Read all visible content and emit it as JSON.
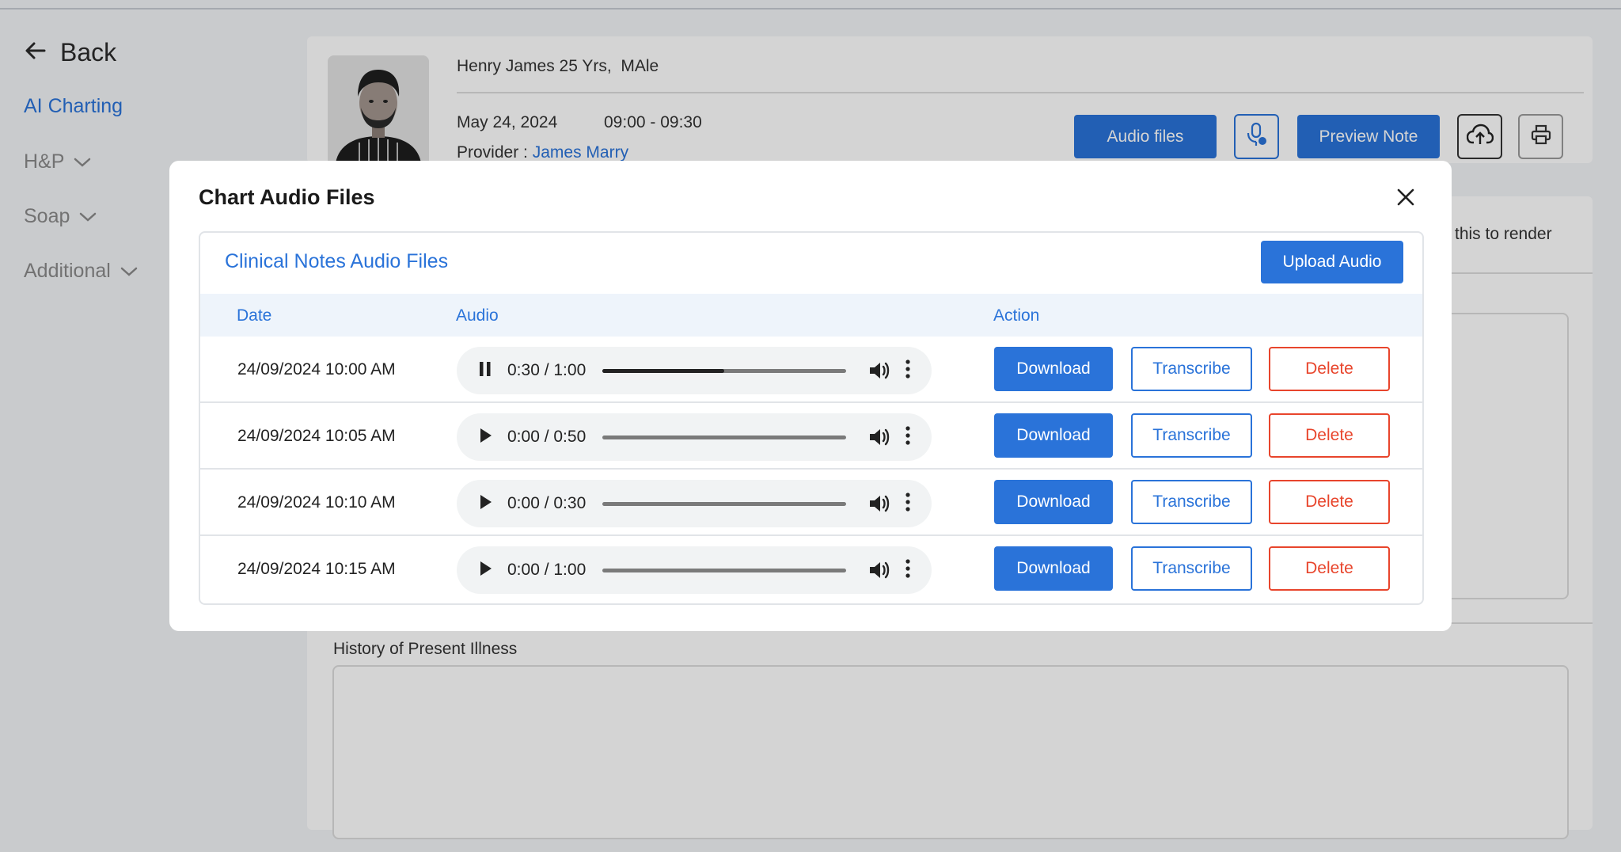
{
  "sidebar": {
    "back_label": "Back",
    "items": [
      {
        "label": "AI Charting"
      },
      {
        "label": "H&P"
      },
      {
        "label": "Soap"
      },
      {
        "label": "Additional"
      }
    ]
  },
  "patient": {
    "name_line": "Henry James 25 Yrs,  MAle",
    "date": "May 24, 2024",
    "time": "09:00 - 09:30",
    "provider_label": "Provider :",
    "provider_name": "James Marry"
  },
  "toolbar": {
    "audio_files_label": "Audio files",
    "preview_note_label": "Preview Note"
  },
  "background": {
    "partial_text": "this to render",
    "hpi_label": "History of Present Illness"
  },
  "modal": {
    "title": "Chart Audio Files",
    "section_title": "Clinical Notes Audio Files",
    "upload_label": "Upload Audio",
    "columns": {
      "date": "Date",
      "audio": "Audio",
      "action": "Action"
    },
    "rows": [
      {
        "date": "24/09/2024 10:00 AM",
        "time": "0:30 / 1:00",
        "playing": true,
        "progress": 0.5,
        "download": "Download",
        "transcribe": "Transcribe",
        "delete": "Delete"
      },
      {
        "date": "24/09/2024 10:05 AM",
        "time": "0:00 / 0:50",
        "playing": false,
        "progress": 0,
        "download": "Download",
        "transcribe": "Transcribe",
        "delete": "Delete"
      },
      {
        "date": "24/09/2024 10:10 AM",
        "time": "0:00 / 0:30",
        "playing": false,
        "progress": 0,
        "download": "Download",
        "transcribe": "Transcribe",
        "delete": "Delete"
      },
      {
        "date": "24/09/2024 10:15 AM",
        "time": "0:00 / 1:00",
        "playing": false,
        "progress": 0,
        "download": "Download",
        "transcribe": "Transcribe",
        "delete": "Delete"
      }
    ]
  },
  "colors": {
    "accent": "#2a73d9",
    "danger": "#e8452c",
    "header_bg": "#eef4fb"
  }
}
